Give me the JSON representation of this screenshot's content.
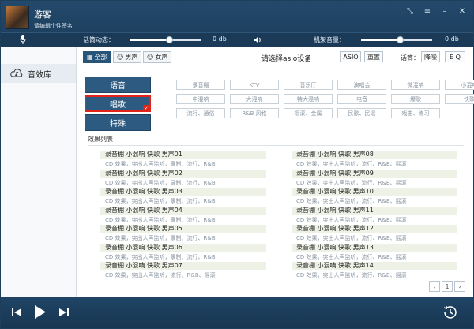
{
  "header": {
    "username": "游客",
    "signature": "请编辑个性签名",
    "mic_label": "话筒动态：",
    "mic_db": "0 db",
    "mic_level": 0.55,
    "monitor_label": "机架音量：",
    "monitor_db": "0 db",
    "monitor_level": 0.55
  },
  "sidebar": {
    "items": [
      {
        "label": "音效库",
        "icon": "cloud-music-icon"
      }
    ]
  },
  "filters": {
    "tabs": [
      {
        "label": "全部",
        "selected": true
      },
      {
        "label": "男声",
        "selected": false
      },
      {
        "label": "女声",
        "selected": false
      }
    ],
    "asio_prompt": "请选择asio设备",
    "asio_button": "ASIO",
    "reset_button": "重置",
    "tone_label": "话筒：",
    "tone_button": "降噪",
    "eq_button": "E Q"
  },
  "categories": [
    {
      "label": "语音",
      "selected": false
    },
    {
      "label": "唱歌",
      "selected": true
    },
    {
      "label": "特殊",
      "selected": false
    }
  ],
  "tags": [
    [
      "录音棚",
      "KTV",
      "音乐厅",
      "演唱会",
      "微混响",
      "小混响"
    ],
    [
      "中混响",
      "大混响",
      "特大混响",
      "电音",
      "爆歌",
      "快歌"
    ],
    [
      "流行、通俗",
      "R&B 风格",
      "摇滚、金属",
      "民歌、民谣",
      "戏曲、练习"
    ]
  ],
  "effects_title": "效果列表",
  "effects": [
    {
      "title": "录音棚 小混响 快歌 男声01",
      "desc": "CD 效果，突出人声监听，录制、流行、R&B"
    },
    {
      "title": "录音棚 小混响 快歌 男声02",
      "desc": "CD 效果，突出人声监听，录制、流行、R&B"
    },
    {
      "title": "录音棚 小混响 快歌 男声03",
      "desc": "CD 效果，突出人声监听，录制、流行、R&B"
    },
    {
      "title": "录音棚 小混响 快歌 男声04",
      "desc": "CD 效果，突出人声监听，录制、流行、R&B"
    },
    {
      "title": "录音棚 小混响 快歌 男声05",
      "desc": "CD 效果，突出人声监听，录制、流行、R&B"
    },
    {
      "title": "录音棚 小混响 快歌 男声06",
      "desc": "CD 效果，突出人声监听，录制、流行、R&B"
    },
    {
      "title": "录音棚 小混响 快歌 男声07",
      "desc": "CD 效果，突出人声监听，流行、R&B、摇滚"
    },
    {
      "title": "录音棚 小混响 快歌 男声08",
      "desc": "CD 效果，突出人声监听，流行、R&B、摇滚"
    },
    {
      "title": "录音棚 小混响 快歌 男声09",
      "desc": "CD 效果，突出人声监听，流行、R&B、摇滚"
    },
    {
      "title": "录音棚 小混响 快歌 男声10",
      "desc": "CD 效果，突出人声监听，流行、R&B、摇滚"
    },
    {
      "title": "录音棚 小混响 快歌 男声11",
      "desc": "CD 效果，突出人声监听，流行、R&B、摇滚"
    },
    {
      "title": "录音棚 小混响 快歌 男声12",
      "desc": "CD 效果，突出人声监听，流行、R&B、摇滚"
    },
    {
      "title": "录音棚 小混响 快歌 男声13",
      "desc": "CD 效果，突出人声监听，流行、R&B、摇滚"
    },
    {
      "title": "录音棚 小混响 快歌 男声14",
      "desc": "CD 效果，突出人声监听，流行、R&B、摇滚"
    }
  ],
  "pagination": {
    "prev": "‹",
    "page": "1",
    "next": "›"
  },
  "colors": {
    "header": "#1c3d5b",
    "accent": "#2d5a80",
    "selected_border": "#e2231a"
  }
}
